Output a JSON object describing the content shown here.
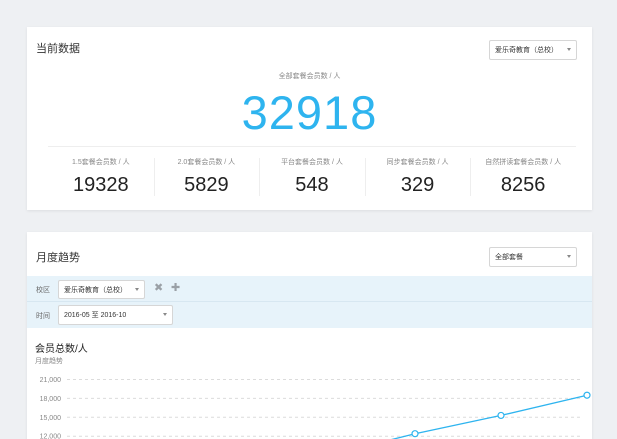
{
  "current": {
    "title": "当前数据",
    "campus_select": "爱乐奇教育（总校）",
    "total_label": "全部套餐会员数 / 人",
    "total_value": "32918",
    "stats": [
      {
        "label": "1.5套餐会员数 / 人",
        "value": "19328"
      },
      {
        "label": "2.0套餐会员数 / 人",
        "value": "5829"
      },
      {
        "label": "平台套餐会员数 / 人",
        "value": "548"
      },
      {
        "label": "同步套餐会员数 / 人",
        "value": "329"
      },
      {
        "label": "自然拼读套餐会员数 / 人",
        "value": "8256"
      }
    ]
  },
  "trend": {
    "title": "月度趋势",
    "package_select": "全部套餐",
    "filters": {
      "campus_label": "校区",
      "campus_value": "爱乐奇教育（总校）",
      "time_label": "时间",
      "time_value": "2016-05 至 2016-10"
    },
    "icons": {
      "remove": "close-x-icon",
      "add": "plus-icon"
    }
  },
  "chart_data": {
    "type": "line",
    "title": "会员总数/人",
    "subtitle": "月度趋势",
    "y_ticks": [
      "21,000",
      "18,000",
      "15,000",
      "12,000"
    ],
    "ylim": [
      9500,
      22500
    ],
    "grid": true,
    "series": [
      {
        "color": "#2eb4ef",
        "points": [
          [
            3,
            9000
          ],
          [
            4,
            12400
          ],
          [
            5,
            15300
          ],
          [
            6,
            18500
          ]
        ]
      }
    ]
  },
  "colors": {
    "accent": "#2eb4ef",
    "filter_band": "#e7f3fa"
  }
}
